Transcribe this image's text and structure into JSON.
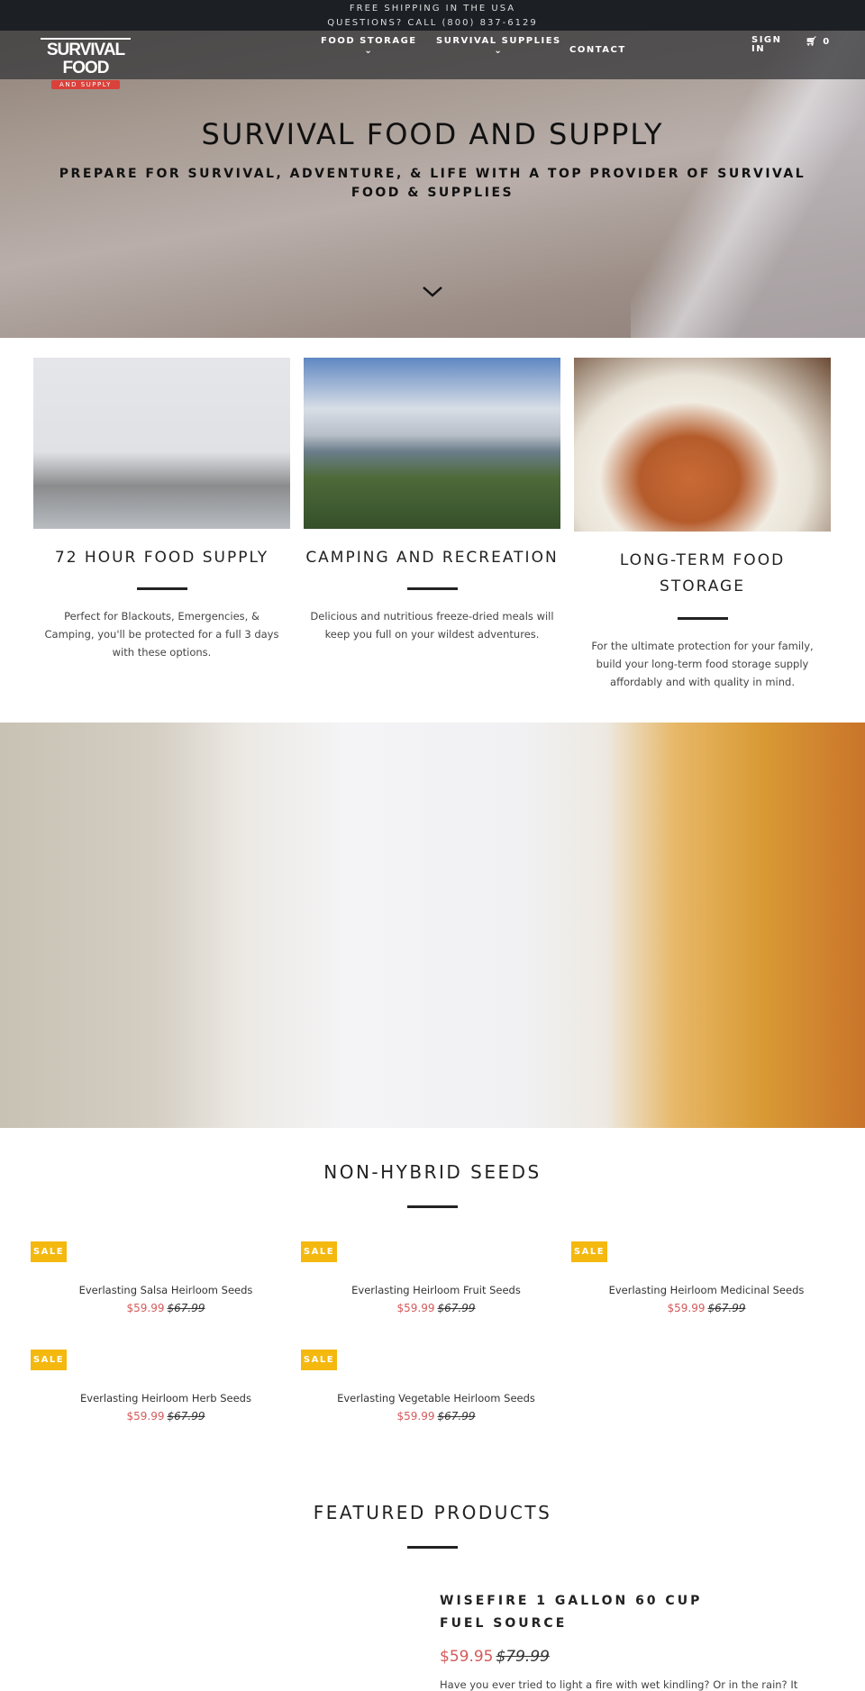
{
  "topbar": {
    "line1": "FREE SHIPPING IN THE USA",
    "line2": "QUESTIONS? CALL (800) 837-6129"
  },
  "logo": {
    "title": "SURVIVAL FOOD",
    "subtitle": "AND SUPPLY"
  },
  "nav": {
    "items": [
      "FOOD STORAGE",
      "SURVIVAL SUPPLIES",
      "CONTACT"
    ],
    "sign_in": "SIGN IN",
    "cart_count": "0"
  },
  "hero": {
    "title": "SURVIVAL FOOD AND SUPPLY",
    "subtitle": "PREPARE FOR SURVIVAL, ADVENTURE, & LIFE WITH A TOP PROVIDER OF SURVIVAL FOOD & SUPPLIES"
  },
  "cards": [
    {
      "title": "72 HOUR FOOD SUPPLY",
      "text": "Perfect for Blackouts, Emergencies, & Camping, you'll be protected for a full 3 days with these options."
    },
    {
      "title": "CAMPING AND RECREATION",
      "text": "Delicious and nutritious freeze-dried meals will keep you full on your wildest adventures."
    },
    {
      "title": "LONG-TERM FOOD STORAGE",
      "text": "For the ultimate protection for your family, build your long-term food storage supply affordably and with quality in mind."
    }
  ],
  "seeds": {
    "heading": "NON-HYBRID SEEDS",
    "badge": "SALE",
    "products": [
      {
        "name": "Everlasting Salsa Heirloom Seeds",
        "price": "$59.99",
        "was": "$67.99"
      },
      {
        "name": "Everlasting Heirloom Fruit Seeds",
        "price": "$59.99",
        "was": "$67.99"
      },
      {
        "name": "Everlasting Heirloom Medicinal Seeds",
        "price": "$59.99",
        "was": "$67.99"
      },
      {
        "name": "Everlasting Heirloom Herb Seeds",
        "price": "$59.99",
        "was": "$67.99"
      },
      {
        "name": "Everlasting Vegetable Heirloom Seeds",
        "price": "$59.99",
        "was": "$67.99"
      }
    ]
  },
  "featured": {
    "heading": "FEATURED PRODUCTS",
    "title": "WISEFIRE 1 GALLON 60 CUP FUEL SOURCE",
    "price": "$59.95",
    "was": "$79.99",
    "description": "Have you ever tried to light a fire with wet kindling? Or in the rain? It"
  },
  "colors": {
    "sale_badge": "#f4b80f",
    "sale_price": "#d45a5a",
    "topbar": "#1c1f24"
  }
}
